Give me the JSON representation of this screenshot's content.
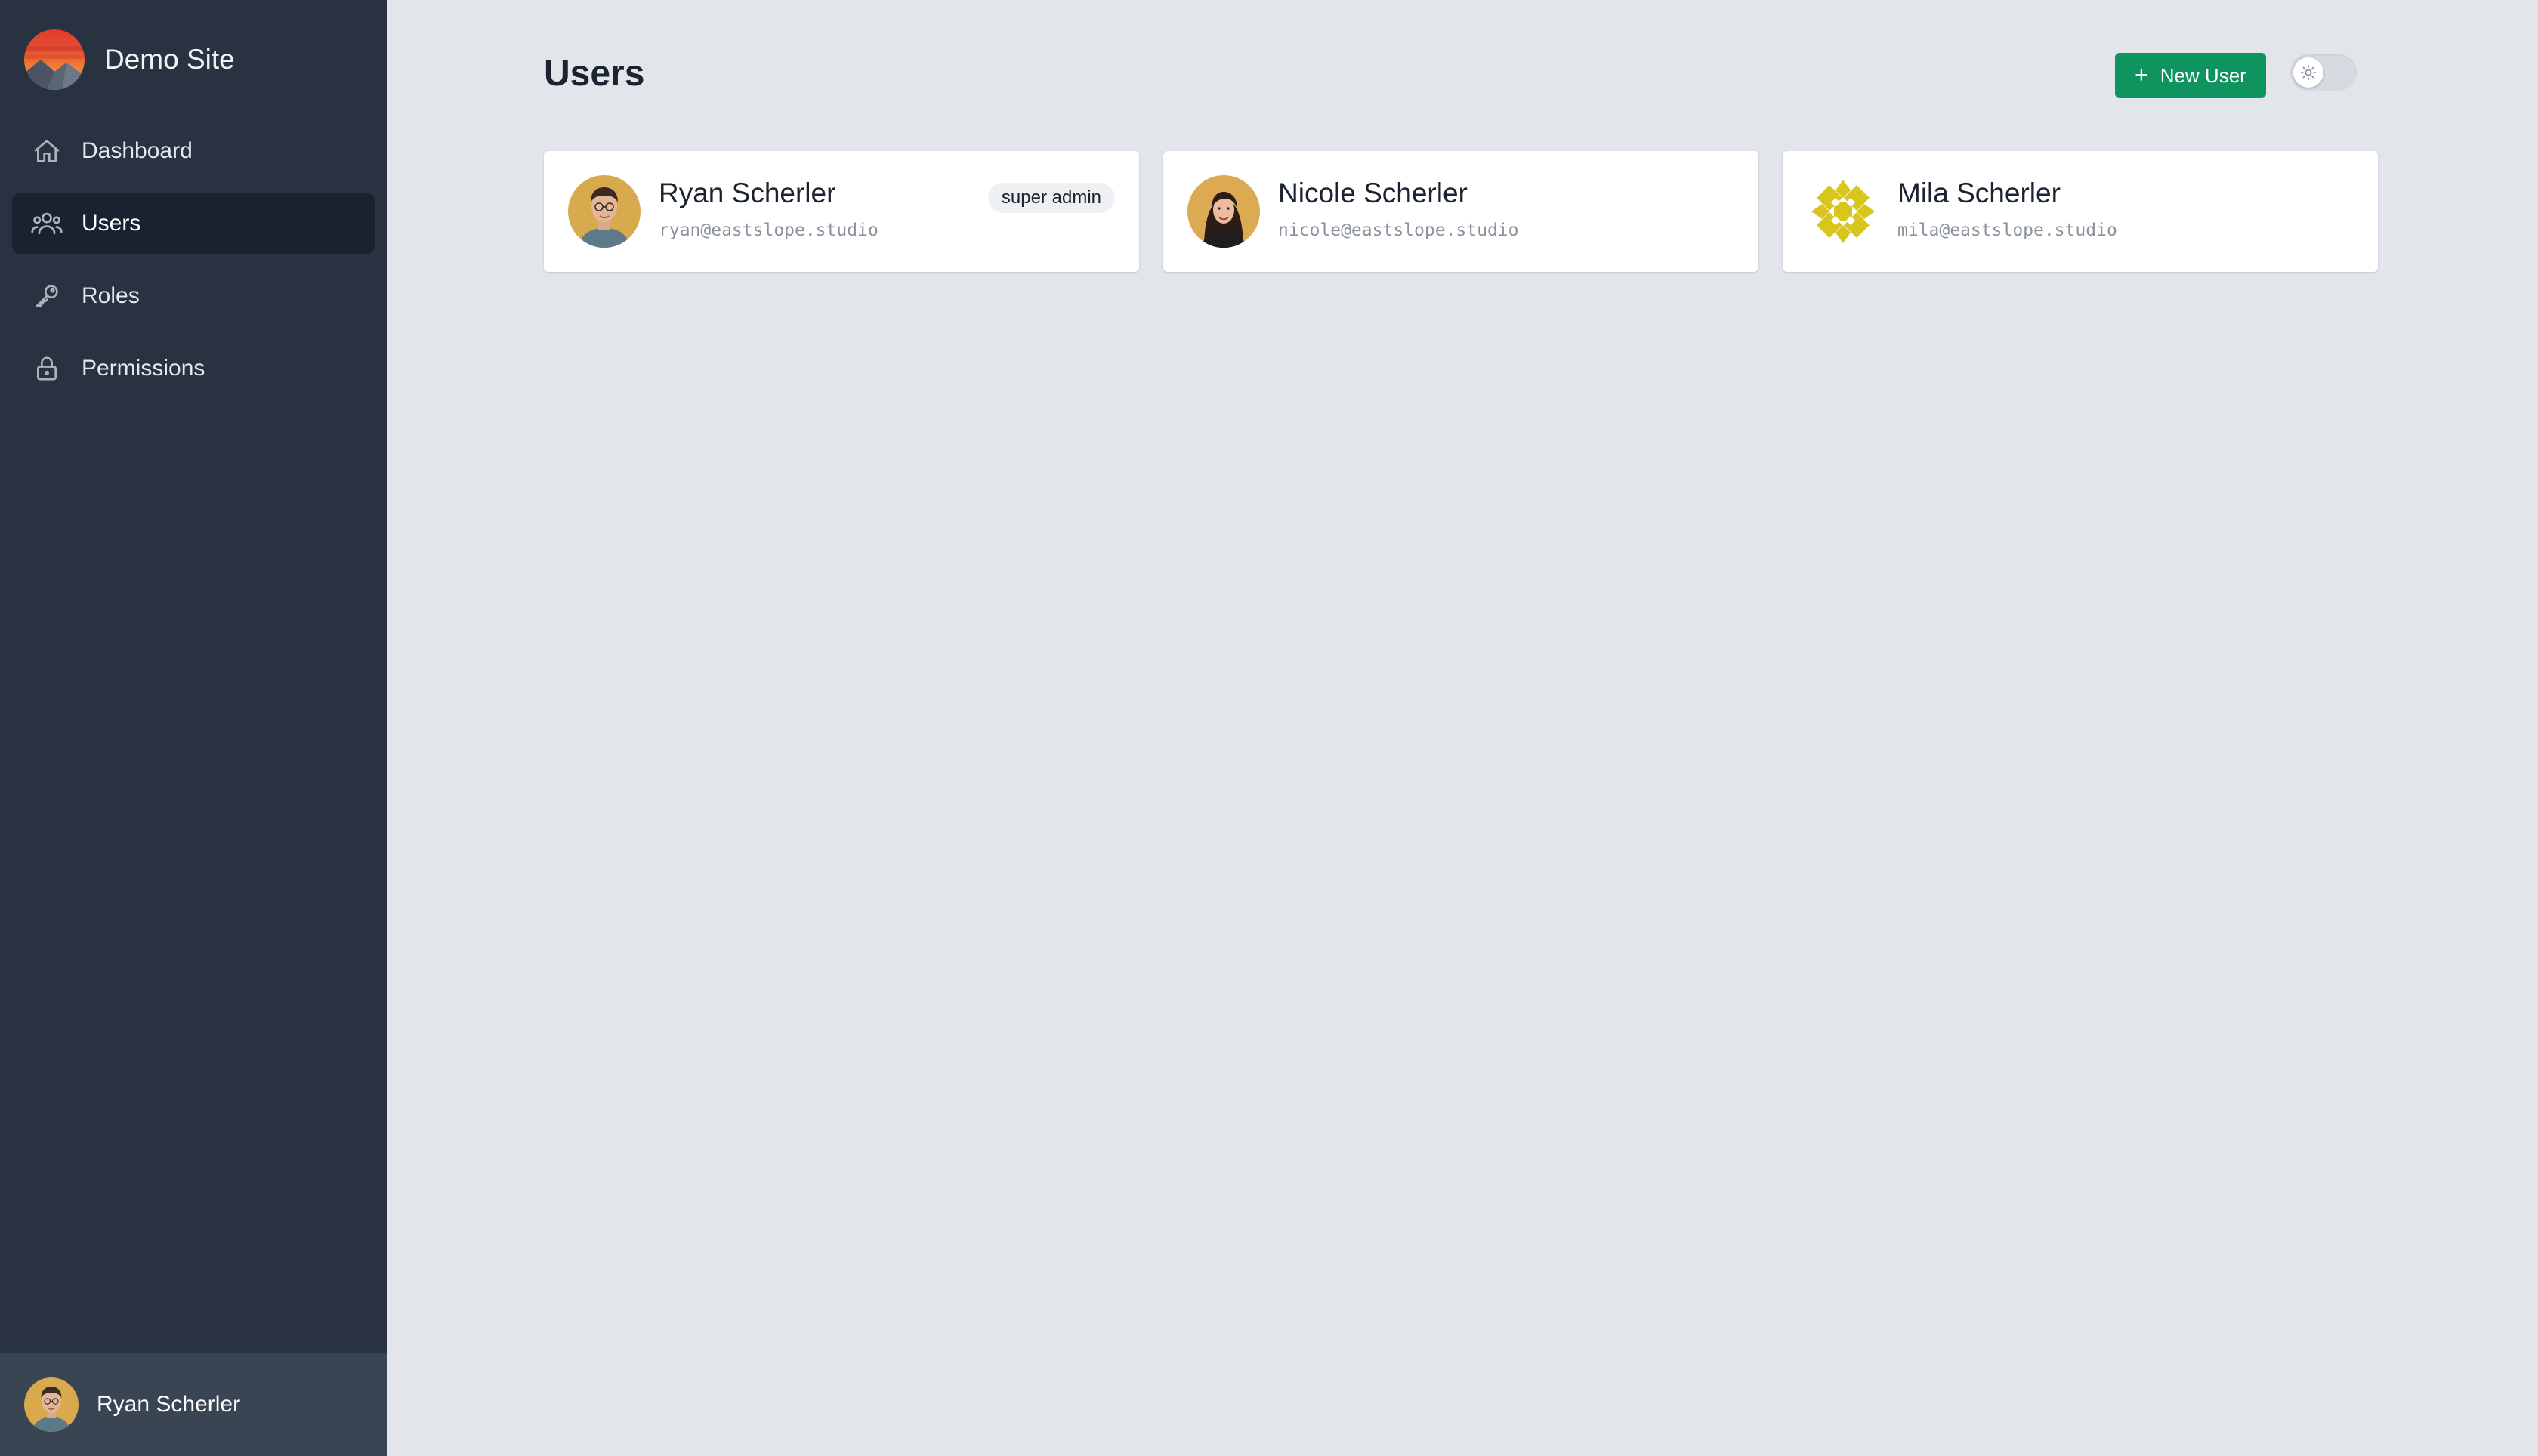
{
  "sidebar": {
    "site_name": "Demo Site",
    "items": [
      {
        "label": "Dashboard",
        "icon": "home-icon",
        "active": false
      },
      {
        "label": "Users",
        "icon": "users-icon",
        "active": true
      },
      {
        "label": "Roles",
        "icon": "key-icon",
        "active": false
      },
      {
        "label": "Permissions",
        "icon": "lock-icon",
        "active": false
      }
    ],
    "current_user": {
      "name": "Ryan Scherler"
    }
  },
  "header": {
    "title": "Users",
    "new_user_label": "New User",
    "theme_toggle": {
      "state": "light",
      "icon": "sun-icon"
    }
  },
  "users": [
    {
      "name": "Ryan Scherler",
      "email": "ryan@eastslope.studio",
      "badge": "super admin"
    },
    {
      "name": "Nicole Scherler",
      "email": "nicole@eastslope.studio"
    },
    {
      "name": "Mila Scherler",
      "email": "mila@eastslope.studio"
    }
  ],
  "colors": {
    "sidebar_bg": "#283240",
    "sidebar_active": "#1a2230",
    "page_bg": "#e2e6eb",
    "primary_button": "#0f9460"
  }
}
